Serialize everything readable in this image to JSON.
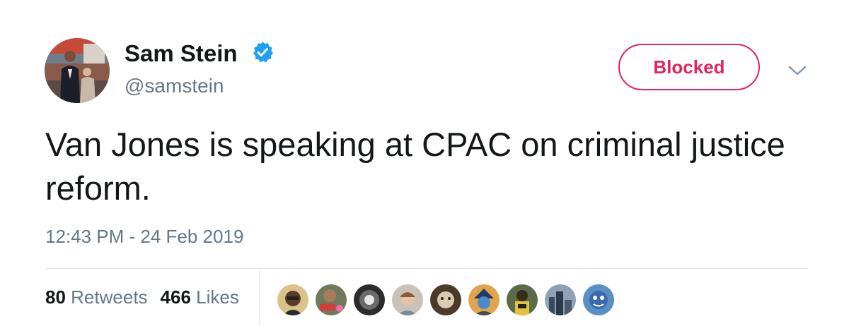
{
  "tweet": {
    "author": {
      "display_name": "Sam Stein",
      "handle": "@samstein",
      "verified": true,
      "avatar_icon": "profile-photo"
    },
    "follow_state_label": "Blocked",
    "more_icon": "chevron-down-icon",
    "text": "Van Jones is speaking at CPAC on criminal justice reform.",
    "timestamp": "12:43 PM - 24 Feb 2019",
    "stats": {
      "retweets_count": "80",
      "retweets_label": "Retweets",
      "likes_count": "466",
      "likes_label": "Likes"
    },
    "likers_count_shown": 9
  },
  "colors": {
    "text_primary": "#14171a",
    "text_secondary": "#657786",
    "blocked_red": "#e0245e",
    "verified_blue": "#1da1f2",
    "divider": "#e1e8ed"
  }
}
